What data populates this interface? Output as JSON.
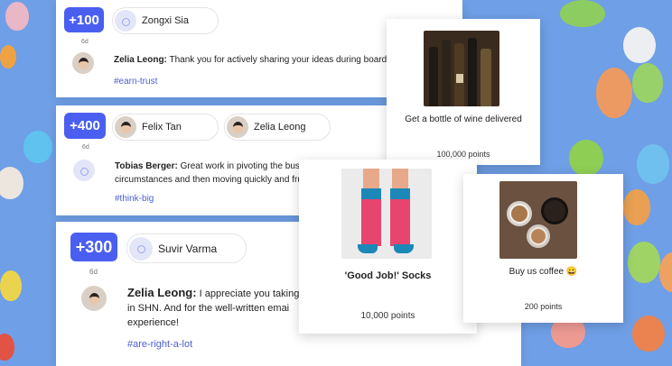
{
  "feed": [
    {
      "points": "+100",
      "recipients": [
        {
          "name": "Zongxi Sia"
        }
      ],
      "age": "6d",
      "sender": "Zelia Leong:",
      "message": "Thank you for actively sharing your ideas during board m",
      "tag": "#earn-trust"
    },
    {
      "points": "+400",
      "recipients": [
        {
          "name": "Felix Tan"
        },
        {
          "name": "Zelia Leong"
        }
      ],
      "age": "6d",
      "sender": "Tobias Berger:",
      "message_lines": [
        "Great work in pivoting the bus",
        "circumstances and then moving quickly and fru"
      ],
      "tag": "#think-big"
    },
    {
      "points": "+300",
      "recipients": [
        {
          "name": "Suvir Varma"
        }
      ],
      "age": "6d",
      "sender": "Zelia Leong:",
      "message_lines": [
        "I appreciate you taking",
        "in SHN. And for the well-written emai",
        "experience!"
      ],
      "tag": "#are-right-a-lot"
    }
  ],
  "rewards": [
    {
      "title": "Get a bottle of wine delivered",
      "points": "100,000 points",
      "image": "wine-bottles-image"
    },
    {
      "title": "'Good Job!' Socks",
      "points": "10,000 points",
      "image": "socks-image"
    },
    {
      "title": "Buy us coffee 😀",
      "points": "200 points",
      "image": "coffee-cups-image"
    }
  ],
  "colors": {
    "accent": "#4a5ff0",
    "tag": "#4a5fd0",
    "background": "#6f9fe6"
  }
}
